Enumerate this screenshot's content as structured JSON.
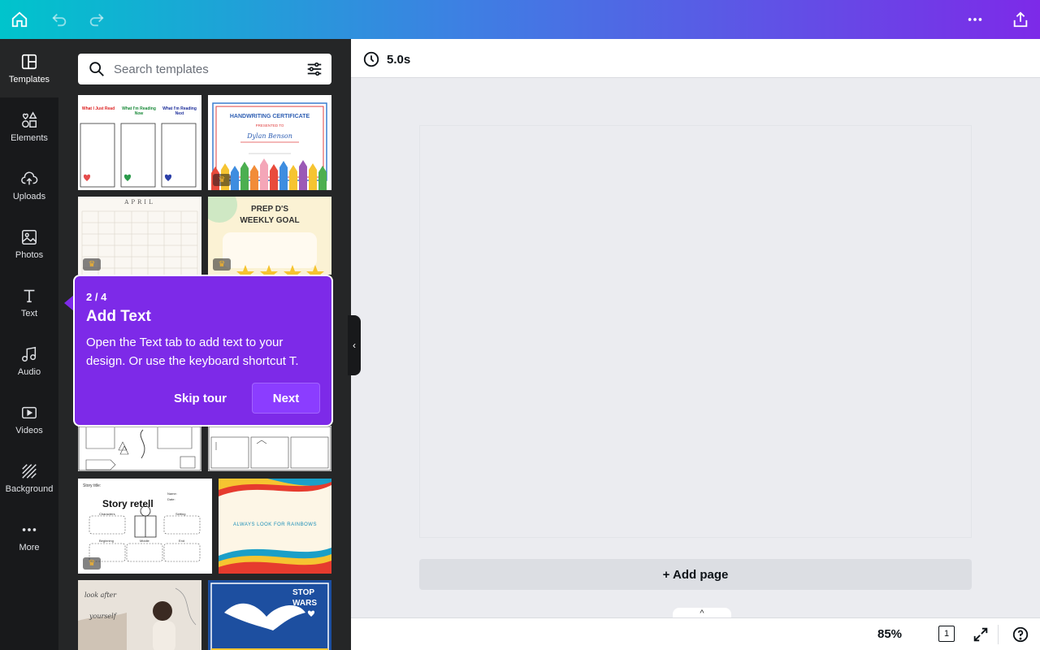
{
  "header": {
    "icons": [
      "home-icon",
      "undo-icon",
      "redo-icon",
      "more-icon",
      "share-icon"
    ]
  },
  "sidebar": {
    "items": [
      {
        "label": "Templates",
        "icon": "templates-icon"
      },
      {
        "label": "Elements",
        "icon": "elements-icon"
      },
      {
        "label": "Uploads",
        "icon": "uploads-icon"
      },
      {
        "label": "Photos",
        "icon": "photos-icon"
      },
      {
        "label": "Text",
        "icon": "text-icon"
      },
      {
        "label": "Audio",
        "icon": "audio-icon"
      },
      {
        "label": "Videos",
        "icon": "videos-icon"
      },
      {
        "label": "Background",
        "icon": "background-icon"
      },
      {
        "label": "More",
        "icon": "more-icon"
      }
    ]
  },
  "panel": {
    "search": {
      "placeholder": "Search templates"
    },
    "templates": {
      "reading_headers": [
        "What I Just Read",
        "What I'm Reading Now",
        "What I'm Reading Next"
      ],
      "certificate_title": "HANDWRITING CERTIFICATE",
      "certificate_presented": "PRESENTED TO",
      "certificate_name": "Dylan Benson",
      "calendar_month": "APRIL",
      "weekly_goal_title": "PREP D'S",
      "weekly_goal_subtitle": "WEEKLY GOAL",
      "story_title_label": "Story title:",
      "story_heading": "Story retell",
      "story_labels": [
        "Characters",
        "Setting",
        "Beginning",
        "Middle",
        "End"
      ],
      "story_fields": [
        "Name:",
        "Date:"
      ],
      "rainbow_text": "ALWAYS LOOK FOR RAINBOWS",
      "selfcare_text": [
        "look after",
        "yourself"
      ],
      "stopwars_text": [
        "STOP",
        "WARS"
      ]
    }
  },
  "tour": {
    "step": "2 / 4",
    "title": "Add Text",
    "description": "Open the Text tab to add text to your design. Or use the keyboard shortcut T.",
    "skip_label": "Skip tour",
    "next_label": "Next"
  },
  "canvas": {
    "duration": "5.0s",
    "add_page_label": "+ Add page",
    "pages_toggle": "^"
  },
  "footer": {
    "zoom": "85%",
    "page_count": "1"
  },
  "colors": {
    "accent": "#7d2ae8",
    "gradient_start": "#00c4cc",
    "gradient_end": "#7d2ae8",
    "rail_bg": "#18191b",
    "panel_bg": "#252627"
  }
}
